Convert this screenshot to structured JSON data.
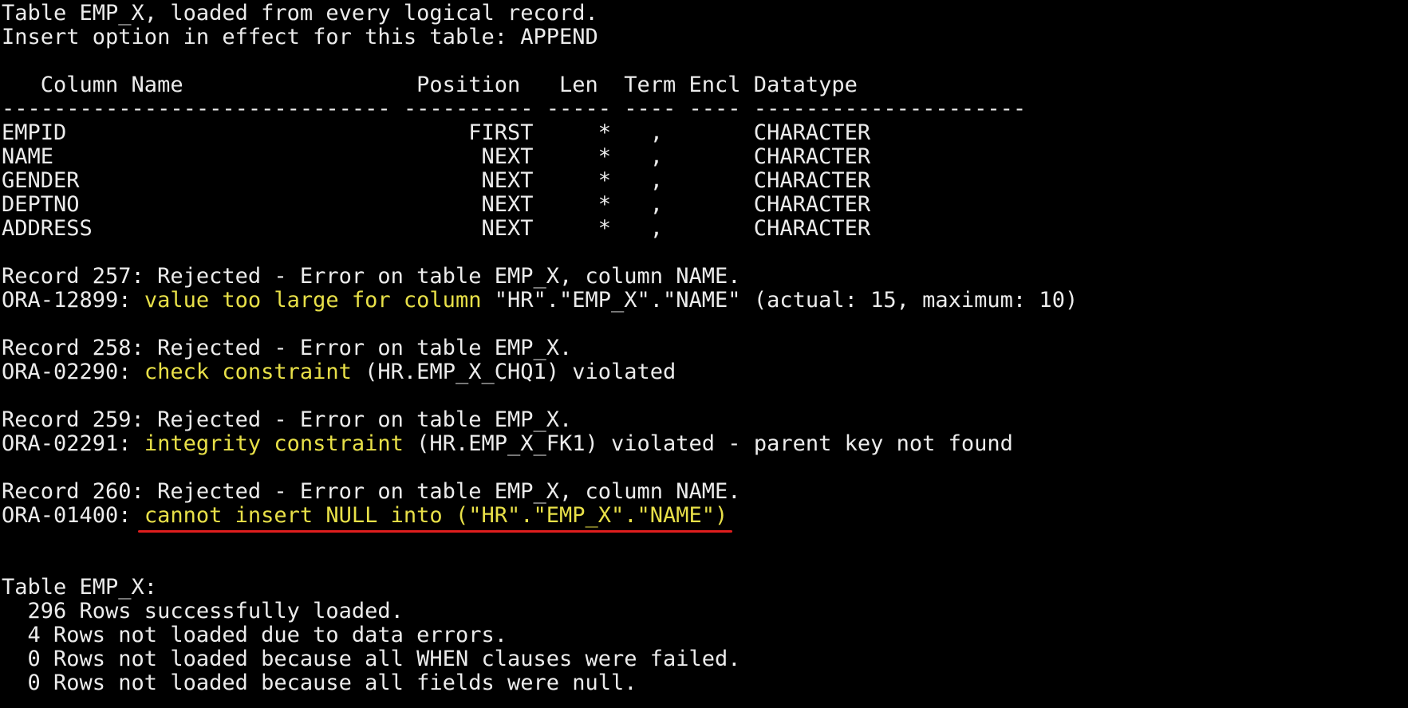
{
  "header": {
    "line1": "Table EMP_X, loaded from every logical record.",
    "line2": "Insert option in effect for this table: APPEND"
  },
  "columns_header": {
    "line": "   Column Name                  Position   Len  Term Encl Datatype",
    "rule": "------------------------------ ---------- ----- ---- ---- ---------------------"
  },
  "columns": [
    {
      "text": "EMPID                               FIRST     *   ,       CHARACTER"
    },
    {
      "text": "NAME                                 NEXT     *   ,       CHARACTER"
    },
    {
      "text": "GENDER                               NEXT     *   ,       CHARACTER"
    },
    {
      "text": "DEPTNO                               NEXT     *   ,       CHARACTER"
    },
    {
      "text": "ADDRESS                              NEXT     *   ,       CHARACTER"
    }
  ],
  "errors": [
    {
      "record": "Record 257: Rejected - Error on table EMP_X, column NAME.",
      "code": "ORA-12899: ",
      "message": "value too large for column",
      "detail": " \"HR\".\"EMP_X\".\"NAME\" (actual: 15, maximum: 10)"
    },
    {
      "record": "Record 258: Rejected - Error on table EMP_X.",
      "code": "ORA-02290: ",
      "message": "check constraint",
      "detail": " (HR.EMP_X_CHQ1) violated"
    },
    {
      "record": "Record 259: Rejected - Error on table EMP_X.",
      "code": "ORA-02291: ",
      "message": "integrity constraint",
      "detail": " (HR.EMP_X_FK1) violated - parent key not found"
    },
    {
      "record": "Record 260: Rejected - Error on table EMP_X, column NAME.",
      "code": "ORA-01400: ",
      "message": "cannot insert NULL into (\"HR\".\"EMP_X\".\"NAME\")"
    }
  ],
  "summary": {
    "title": "Table EMP_X:",
    "lines": [
      "  296 Rows successfully loaded.",
      "  4 Rows not loaded due to data errors.",
      "  0 Rows not loaded because all WHEN clauses were failed.",
      "  0 Rows not loaded because all fields were null."
    ]
  },
  "colors": {
    "background": "#000000",
    "text": "#ececec",
    "highlight": "#e8e048",
    "underline": "#e01e1e"
  }
}
